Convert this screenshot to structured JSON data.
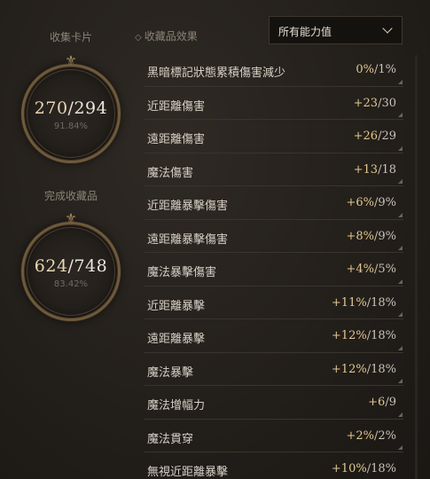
{
  "left": {
    "cards_label": "收集卡片",
    "cards_current": "270",
    "cards_total": "294",
    "cards_pct": "91.84%",
    "collect_label": "完成收藏品",
    "collect_current": "624",
    "collect_total": "748",
    "collect_pct": "83.42%"
  },
  "filter": {
    "title": "收藏品效果",
    "dropdown_value": "所有能力值"
  },
  "stats": [
    {
      "name": "黑暗標記狀態累積傷害減少",
      "cur": "0%",
      "max": "1%"
    },
    {
      "name": "近距離傷害",
      "cur": "+23",
      "max": "30"
    },
    {
      "name": "遠距離傷害",
      "cur": "+26",
      "max": "29"
    },
    {
      "name": "魔法傷害",
      "cur": "+13",
      "max": "18"
    },
    {
      "name": "近距離暴擊傷害",
      "cur": "+6%",
      "max": "9%"
    },
    {
      "name": "遠距離暴擊傷害",
      "cur": "+8%",
      "max": "9%"
    },
    {
      "name": "魔法暴擊傷害",
      "cur": "+4%",
      "max": "5%"
    },
    {
      "name": "近距離暴擊",
      "cur": "+11%",
      "max": "18%"
    },
    {
      "name": "遠距離暴擊",
      "cur": "+12%",
      "max": "18%"
    },
    {
      "name": "魔法暴擊",
      "cur": "+12%",
      "max": "18%"
    },
    {
      "name": "魔法增幅力",
      "cur": "+6",
      "max": "9"
    },
    {
      "name": "魔法貫穿",
      "cur": "+2%",
      "max": "2%"
    },
    {
      "name": "無視近距離暴擊",
      "cur": "+10%",
      "max": "18%"
    }
  ]
}
